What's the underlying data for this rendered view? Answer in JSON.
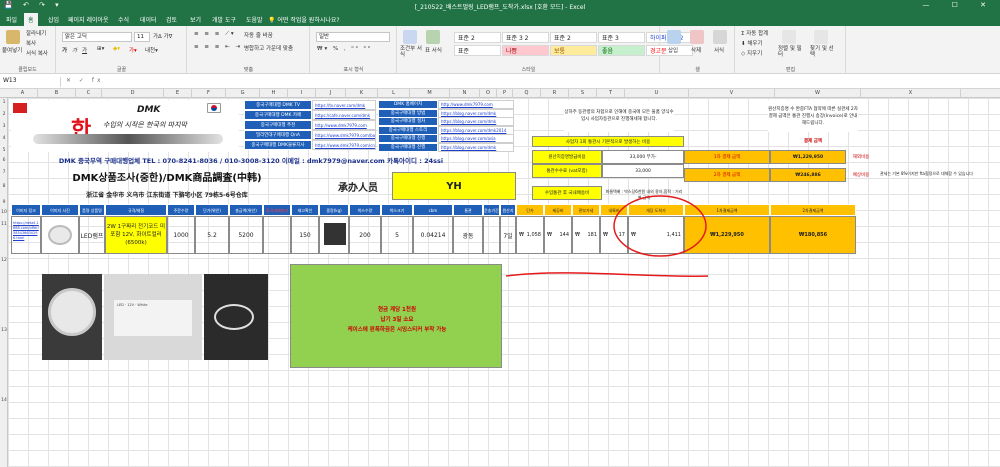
{
  "app": {
    "title": "[_210522_배스트멀링_LED램프_도착가.xlsx [호환 모드] - Excel",
    "tabs": [
      "파일",
      "홈",
      "삽입",
      "페이지 레이아웃",
      "수식",
      "데이터",
      "검토",
      "보기",
      "개발 도구",
      "도움말"
    ],
    "tell_me": "어떤 작업을 원하시나요?"
  },
  "ribbon": {
    "paste": "붙여넣기",
    "cut": "잘라내기",
    "copy": "복사",
    "format_painter": "서식 복사",
    "clipboard_label": "클립보드",
    "font_name": "맑은 고딕",
    "font_size": "11",
    "font_label": "글꼴",
    "wrap_text": "자동 줄 바꿈",
    "merge_center": "병합하고 가운데 맞춤",
    "align_label": "맞춤",
    "number_format": "일반",
    "number_label": "표시 형식",
    "cond_format": "조건부 서식",
    "format_table": "표 서식",
    "styles": [
      {
        "label": "표준 2",
        "bg": "#ffffff",
        "color": "#222222"
      },
      {
        "label": "표준 3 2",
        "bg": "#ffffff",
        "color": "#222222"
      },
      {
        "label": "표준 2",
        "bg": "#ffffff",
        "color": "#222222"
      },
      {
        "label": "표준 3",
        "bg": "#ffffff",
        "color": "#222222"
      },
      {
        "label": "하이퍼링크 2",
        "bg": "#ffffff",
        "color": "#1f3fcf"
      },
      {
        "label": "표준",
        "bg": "#ffffff",
        "color": "#222222"
      },
      {
        "label": "나쁨",
        "bg": "#ffc7ce",
        "color": "#9c0006"
      },
      {
        "label": "보통",
        "bg": "#ffeb9c",
        "color": "#9c5700"
      },
      {
        "label": "좋음",
        "bg": "#c6efce",
        "color": "#006100"
      },
      {
        "label": "경고문",
        "bg": "#ffffff",
        "color": "#ff0000"
      }
    ],
    "styles_label": "스타일",
    "insert": "삽입",
    "delete": "삭제",
    "format": "서식",
    "cells_label": "셀",
    "autosum": "자동 합계",
    "fill": "채우기",
    "clear": "지우기",
    "sort_filter": "정렬 및 필터",
    "find_select": "찾기 및 선택",
    "edit_label": "편집"
  },
  "formula_bar": {
    "cell_ref": "W13",
    "formula": ""
  },
  "columns": [
    "A",
    "B",
    "C",
    "D",
    "E",
    "F",
    "G",
    "H",
    "I",
    "J",
    "K",
    "L",
    "M",
    "N",
    "O",
    "P",
    "Q",
    "R",
    "S",
    "T",
    "U",
    "V",
    "W",
    "X"
  ],
  "rows": [
    "1",
    "2",
    "3",
    "4",
    "5",
    "6",
    "7",
    "8",
    "9",
    "10",
    "11",
    "12",
    "13",
    "14"
  ],
  "sheet": {
    "logo_text": "DMK",
    "slogan_red": "한",
    "slogan": "수입의 시작은 한국의 마지막",
    "banners": [
      "중국구매대행 DMK TV",
      "중국구매대행 DMK 카페",
      "중국구매대행 추천",
      "밀리언대구매대행 QnA",
      "중국구매대행 DMK물류지사"
    ],
    "banner_links": [
      "https://tv.naver.com/dmk",
      "https://cafe.naver.com/dmk",
      "http://www.dmk7979.com",
      "https://www.dmk7979.com/board",
      "https://www.dmk7979.com/cn"
    ],
    "banners2": [
      "DMK 홈페이지",
      "중국구매대행 방법",
      "중국구매대행 절차",
      "중국구매대행 스토리",
      "중국구매대행 진행",
      "중국구매대행 진행"
    ],
    "banner2_links": [
      "http://www.dmk7979.com",
      "https://blog.naver.com/dmk",
      "https://blog.naver.com/dmk",
      "https://blog.naver.com/dmk2014",
      "https://blog.naver.com/asia",
      "https://blog.naver.com/dmk"
    ],
    "info_note": "상하주 동관병의 처합으로 인해에 중국에 모든 물품 양식수입시 사업자등관으로 진행해세해 합니다.",
    "contact": "DMK 중국무역 구매대행업체 TEL : 070-8241-8036 / 010-3008-3120 이메일 : dmk7979@naver.com 카톡아이디 : 24ssi",
    "title": "DMK상품조사(중한)/DMK商品調査(中韩)",
    "address": "浙江省 金华市 义乌市 江东街道 下骆宅小区 79栋5-6号仓库",
    "staff_label": "承办人员",
    "staff_name": "YH",
    "headers": [
      "이미지 링크",
      "이미지 사진",
      "품명 상품명",
      "규격/재질",
      "주문수량",
      "단가(위안)",
      "총금액(위안)",
      "중국내배송비",
      "재고확인",
      "중량(kg)",
      "박스수량",
      "박스크기",
      "cbm",
      "통관",
      "운송기간",
      "원산지"
    ],
    "row": {
      "link": "https://detail.1688.com/offer/585436630296.html",
      "product": "LED램프",
      "spec": "2W 1구짜리 전기코드 미포함 12V, 화이트컬러(6500k)",
      "qty": "1000",
      "price": "5.2",
      "total": "5200",
      "shipping": "150",
      "units": "200",
      "boxes": "5",
      "cbm": "0.04214",
      "port": "광동",
      "days": "7일"
    },
    "calc_headers": [
      "단가",
      "제공비",
      "관부가세",
      "내륙비",
      "개당 도착가"
    ],
    "calc_values": [
      "1,058",
      "144",
      "181",
      "17",
      "1,411"
    ],
    "calc_currency": "₩",
    "right_labels": {
      "exchange": "원산지증명발급비용",
      "exchange_val": "33,000 부가-",
      "customs": "통관수수료 (vat포함)",
      "customs_val": "33,000",
      "ship_note": "사업자 1회 통관시 기본적으로 발생하는 비용",
      "import_label": "수입통관 후 국내배송비",
      "import_note": "화물택배 : 박스당6천원 내외 용차,합적 : 거리별 금액",
      "pay1": "1차 결제 금액",
      "pay1_val": "₩1,229,950",
      "pay2": "2차 결제 금액",
      "pay2_val": "₩246,886",
      "ship_cost": "해외비용",
      "ship_cost2": "예상비용",
      "fta_note": "원산지증명 수 완중FTA 협약에 따른 실관세 2차결제 금액은 통관 진행시 송장(Invoice)로 안내해드립니다.",
      "total_label": "결제 금액",
      "customs_note": "관세는 기본 8%이지만 fta협정으로 대체함 수 있습니다",
      "sum1_label": "1차결제금액",
      "sum2_label": "2차결제금액",
      "sum1": "₩1,229,950",
      "sum2": "₩180,856"
    },
    "green_note1": "현금 계당 1천원",
    "green_note2": "납기 3일 소요",
    "green_note3": "케이스에 판폭하끔은 시잉스티커 부착 가능"
  }
}
